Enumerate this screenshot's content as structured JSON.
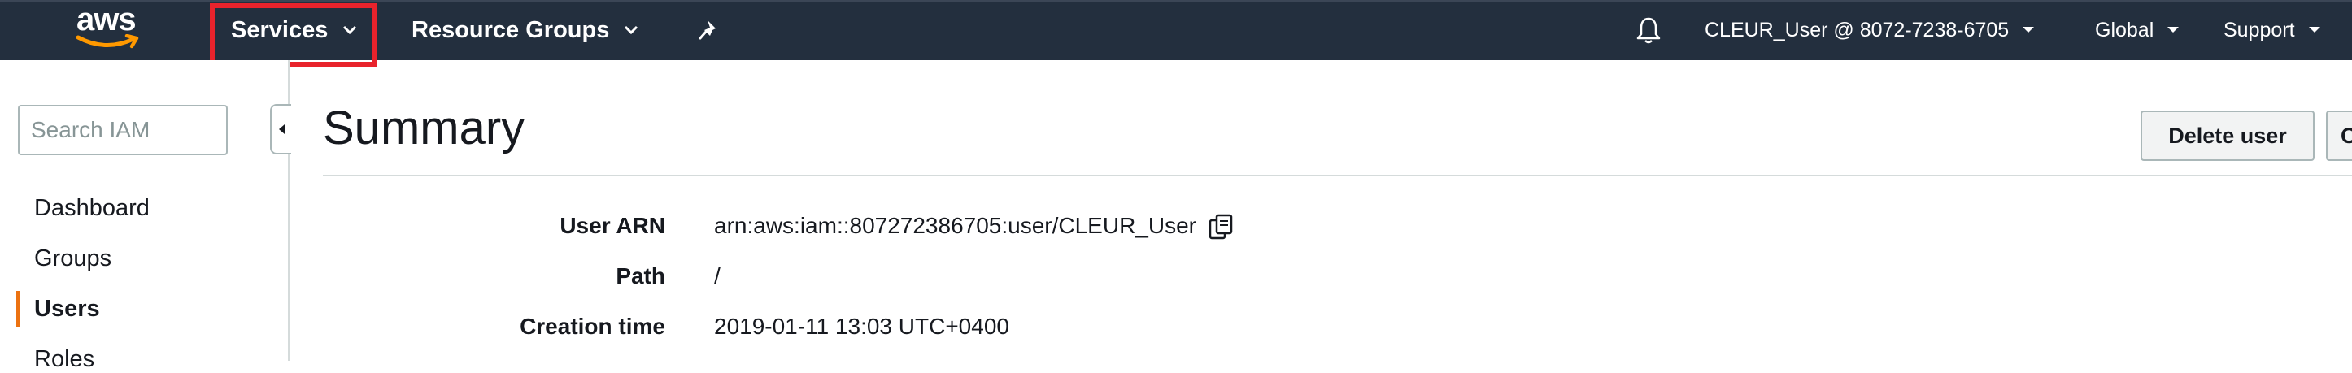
{
  "topbar": {
    "logo_text": "aws",
    "services_label": "Services",
    "resource_groups_label": "Resource Groups",
    "account_label": "CLEUR_User @ 8072-7238-6705",
    "region_label": "Global",
    "support_label": "Support"
  },
  "icons": {
    "pin": "pin-icon",
    "bell": "bell-icon",
    "chevron": "chevron-down-icon",
    "copy": "copy-icon",
    "collapse": "caret-left-icon"
  },
  "sidebar": {
    "search_placeholder": "Search IAM",
    "items": [
      {
        "label": "Dashboard",
        "active": false
      },
      {
        "label": "Groups",
        "active": false
      },
      {
        "label": "Users",
        "active": true
      },
      {
        "label": "Roles",
        "active": false
      }
    ]
  },
  "main": {
    "title": "Summary",
    "delete_button_label": "Delete user",
    "second_button_label": "C",
    "fields": [
      {
        "label": "User ARN",
        "value": "arn:aws:iam::807272386705:user/CLEUR_User"
      },
      {
        "label": "Path",
        "value": "/"
      },
      {
        "label": "Creation time",
        "value": "2019-01-11 13:03 UTC+0400"
      }
    ]
  },
  "colors": {
    "topbar_bg": "#232f3e",
    "highlight_border": "#e8232c",
    "active_indicator": "#ec7211",
    "logo_smile": "#ff9900"
  }
}
